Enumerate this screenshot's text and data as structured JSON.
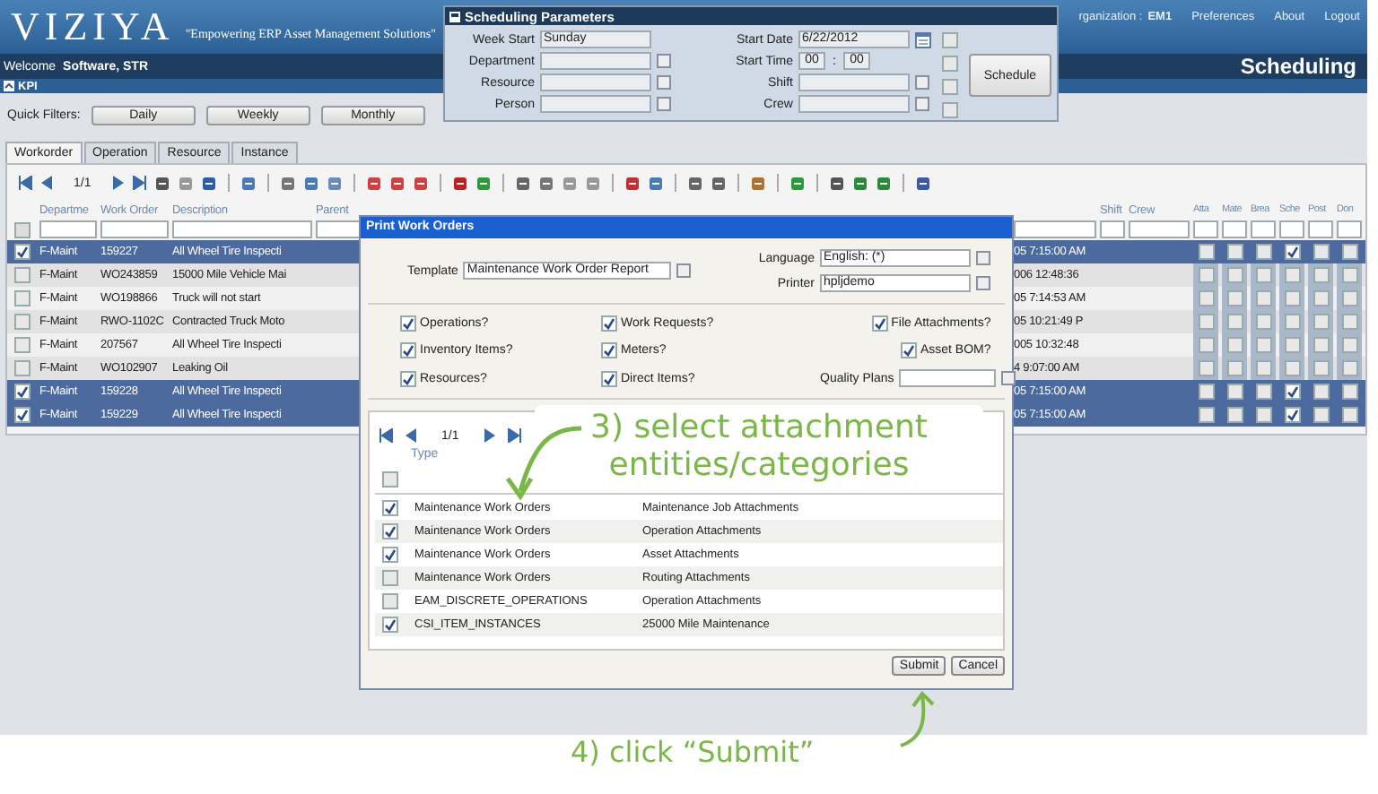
{
  "header": {
    "logo": "VIZIYA",
    "tagline": "\"Empowering ERP Asset Management Solutions\"",
    "organization_label": "rganization :",
    "organization": "EM1",
    "links": [
      "Preferences",
      "About",
      "Logout"
    ],
    "welcome": "Welcome",
    "user": "Software, STR",
    "module": "Scheduling",
    "kpi": "KPI"
  },
  "quick_filters": {
    "label": "Quick Filters:",
    "buttons": [
      "Daily",
      "Weekly",
      "Monthly"
    ]
  },
  "tabs": [
    {
      "label": "Workorder",
      "selected": true
    },
    {
      "label": "Operation",
      "selected": false
    },
    {
      "label": "Resource",
      "selected": false
    },
    {
      "label": "Instance",
      "selected": false
    }
  ],
  "grid": {
    "pager": "1/1",
    "select_all": false,
    "columns_left": [
      "Departme",
      "Work Order",
      "Description",
      "Parent"
    ],
    "columns_right": [
      "Shift",
      "Crew"
    ],
    "flag_columns": [
      "Atta",
      "Mate",
      "Brea",
      "Sche",
      "Post",
      "Don"
    ],
    "rows": [
      {
        "selected": true,
        "checked": true,
        "department": "F-Maint",
        "work_order": "159227",
        "description": "All Wheel Tire Inspecti",
        "end_date": "05 7:15:00 AM",
        "flags": [
          false,
          false,
          false,
          true,
          false,
          false
        ]
      },
      {
        "selected": false,
        "checked": false,
        "department": "F-Maint",
        "work_order": "WO243859",
        "description": "15000 Mile Vehicle Mai",
        "end_date": "006 12:48:36",
        "flags": [
          false,
          false,
          false,
          false,
          false,
          false
        ]
      },
      {
        "selected": false,
        "checked": false,
        "department": "F-Maint",
        "work_order": "WO198866",
        "description": "Truck will not start",
        "end_date": "05 7:14:53 AM",
        "flags": [
          false,
          false,
          false,
          false,
          false,
          false
        ]
      },
      {
        "selected": false,
        "checked": false,
        "department": "F-Maint",
        "work_order": "RWO-1102C",
        "description": "Contracted Truck Moto",
        "end_date": "05 10:21:49 P",
        "flags": [
          false,
          false,
          false,
          false,
          false,
          false
        ]
      },
      {
        "selected": false,
        "checked": false,
        "department": "F-Maint",
        "work_order": "207567",
        "description": "All Wheel Tire Inspecti",
        "end_date": "005 10:32:48",
        "flags": [
          false,
          false,
          false,
          false,
          false,
          false
        ]
      },
      {
        "selected": false,
        "checked": false,
        "department": "F-Maint",
        "work_order": "WO102907",
        "description": "Leaking Oil",
        "end_date": "4 9:07:00 AM",
        "flags": [
          false,
          false,
          false,
          false,
          false,
          false
        ]
      },
      {
        "selected": true,
        "checked": true,
        "department": "F-Maint",
        "work_order": "159228",
        "description": "All Wheel Tire Inspecti",
        "end_date": "05 7:15:00 AM",
        "flags": [
          false,
          false,
          false,
          true,
          false,
          false
        ]
      },
      {
        "selected": true,
        "checked": true,
        "department": "F-Maint",
        "work_order": "159229",
        "description": "All Wheel Tire Inspecti",
        "end_date": "05 7:15:00 AM",
        "flags": [
          false,
          false,
          false,
          true,
          false,
          false
        ]
      }
    ]
  },
  "scheduling_parameters": {
    "title": "Scheduling Parameters",
    "left_fields": [
      {
        "label": "Week Start",
        "value": "Sunday",
        "kind": "text"
      },
      {
        "label": "Department",
        "kind": "lookup"
      },
      {
        "label": "Resource",
        "kind": "lookup"
      },
      {
        "label": "Person",
        "kind": "lookup"
      }
    ],
    "right_fields": [
      {
        "label": "Start Date",
        "value": "6/22/2012",
        "kind": "date"
      },
      {
        "label": "Start Time",
        "hours": "00",
        "separator": ":",
        "minutes": "00",
        "kind": "time"
      },
      {
        "label": "Shift",
        "kind": "lookup"
      },
      {
        "label": "Crew",
        "kind": "lookup"
      }
    ],
    "checkboxes": [
      {
        "checked": false
      },
      {
        "checked": false
      },
      {
        "checked": false
      },
      {
        "checked": false
      }
    ],
    "button": "Schedule"
  },
  "print_dialog": {
    "title": "Print Work Orders",
    "template": {
      "label": "Template",
      "value": "Maintenance Work Order Report"
    },
    "language": {
      "label": "Language",
      "value": "English: (*)"
    },
    "printer": {
      "label": "Printer",
      "value": "hpljdemo"
    },
    "options": [
      {
        "label": "Operations?",
        "checked": true
      },
      {
        "label": "Work Requests?",
        "checked": true
      },
      {
        "label": "File Attachments?",
        "checked": true
      },
      {
        "label": "Inventory Items?",
        "checked": true
      },
      {
        "label": "Meters?",
        "checked": true
      },
      {
        "label": "Asset BOM?",
        "checked": true
      },
      {
        "label": "Resources?",
        "checked": true
      },
      {
        "label": "Direct Items?",
        "checked": true
      }
    ],
    "quality_plans": {
      "label": "Quality Plans"
    },
    "attachments": {
      "pager": "1/1",
      "column": "Type",
      "select_all": false,
      "rows": [
        {
          "checked": true,
          "type": "Maintenance Work Orders",
          "category": "Maintenance Job Attachments"
        },
        {
          "checked": true,
          "type": "Maintenance Work Orders",
          "category": "Operation Attachments"
        },
        {
          "checked": true,
          "type": "Maintenance Work Orders",
          "category": "Asset Attachments"
        },
        {
          "checked": false,
          "type": "Maintenance Work Orders",
          "category": "Routing Attachments"
        },
        {
          "checked": false,
          "type": "EAM_DISCRETE_OPERATIONS",
          "category": "Operation Attachments"
        },
        {
          "checked": true,
          "type": "CSI_ITEM_INSTANCES",
          "category": "25000 Mile Maintenance"
        }
      ]
    },
    "buttons": [
      "Submit",
      "Cancel"
    ]
  },
  "annotations": [
    "3) select attachment entities/categories",
    "4) click “Submit”"
  ]
}
